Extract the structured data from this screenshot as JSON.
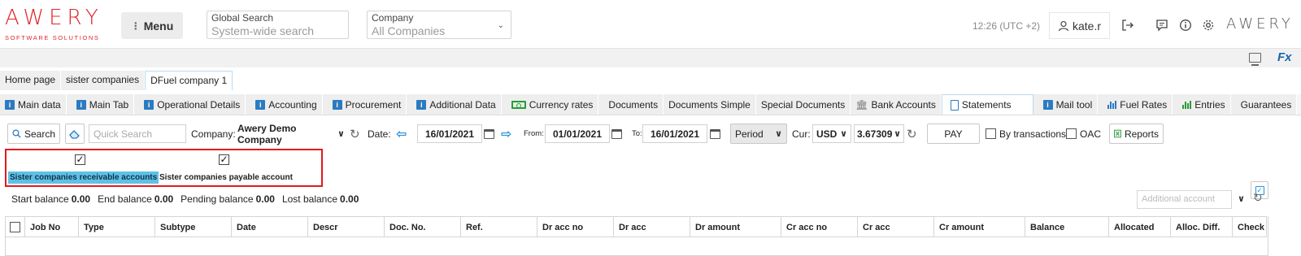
{
  "header": {
    "logo_text": "AWERY",
    "logo_sub": "SOFTWARE SOLUTIONS",
    "menu_label": "Menu",
    "global_search_label": "Global Search",
    "global_search_placeholder": "System-wide search",
    "company_label": "Company",
    "company_value": "All Companies",
    "time": "12:26 (UTC +2)",
    "user": "kate.r",
    "brand_right": "AWERY"
  },
  "band": {
    "fx_label": "Fx"
  },
  "breadcrumbs": [
    "Home page",
    "sister companies",
    "DFuel company 1"
  ],
  "tabs": [
    {
      "label": "Main data",
      "icon": "info"
    },
    {
      "label": "Main Tab",
      "icon": "info"
    },
    {
      "label": "Operational Details",
      "icon": "info"
    },
    {
      "label": "Accounting",
      "icon": "info"
    },
    {
      "label": "Procurement",
      "icon": "info"
    },
    {
      "label": "Additional Data",
      "icon": "info"
    },
    {
      "label": "Currency rates",
      "icon": "money"
    },
    {
      "label": "Documents",
      "icon": ""
    },
    {
      "label": "Documents Simple",
      "icon": ""
    },
    {
      "label": "Special Documents",
      "icon": ""
    },
    {
      "label": "Bank Accounts",
      "icon": "bank"
    },
    {
      "label": "Statements",
      "icon": "doc",
      "active": true
    },
    {
      "label": "Mail tool",
      "icon": "info"
    },
    {
      "label": "Fuel Rates",
      "icon": "bar"
    },
    {
      "label": "Entries",
      "icon": "bar-green"
    },
    {
      "label": "Guarantees",
      "icon": ""
    }
  ],
  "toolbar": {
    "search_label": "Search",
    "quick_search_placeholder": "Quick Search",
    "company_label": "Company:",
    "company_value": "Awery Demo Company",
    "date_label": "Date:",
    "date_value": "16/01/2021",
    "from_label": "From:",
    "from_value": "01/01/2021",
    "to_label": "To:",
    "to_value": "16/01/2021",
    "period_label": "Period",
    "cur_label": "Cur:",
    "cur_value": "USD",
    "rate_value": "3.67309",
    "pay_label": "PAY",
    "by_transactions_label": "By transactions",
    "oac_label": "OAC",
    "reports_label": "Reports"
  },
  "filters": {
    "receivable_label": "Sister companies receivable accounts",
    "payable_label": "Sister companies payable account",
    "receivable_checked": true,
    "payable_checked": true
  },
  "balances": {
    "start_label": "Start balance",
    "start_value": "0.00",
    "end_label": "End balance",
    "end_value": "0.00",
    "pending_label": "Pending balance",
    "pending_value": "0.00",
    "lost_label": "Lost balance",
    "lost_value": "0.00",
    "additional_account_placeholder": "Additional account"
  },
  "table": {
    "columns": [
      "Job No",
      "Type",
      "Subtype",
      "Date",
      "Descr",
      "Doc. No.",
      "Ref.",
      "Dr acc no",
      "Dr acc",
      "Dr amount",
      "Cr acc no",
      "Cr acc",
      "Cr amount",
      "Balance",
      "Allocated",
      "Alloc. Diff.",
      "Check"
    ]
  },
  "colors": {
    "brand_red": "#e0252a",
    "accent_blue": "#2b7bc0",
    "highlight_cyan": "#5ec1e6",
    "annotation_red": "#e2191e"
  }
}
